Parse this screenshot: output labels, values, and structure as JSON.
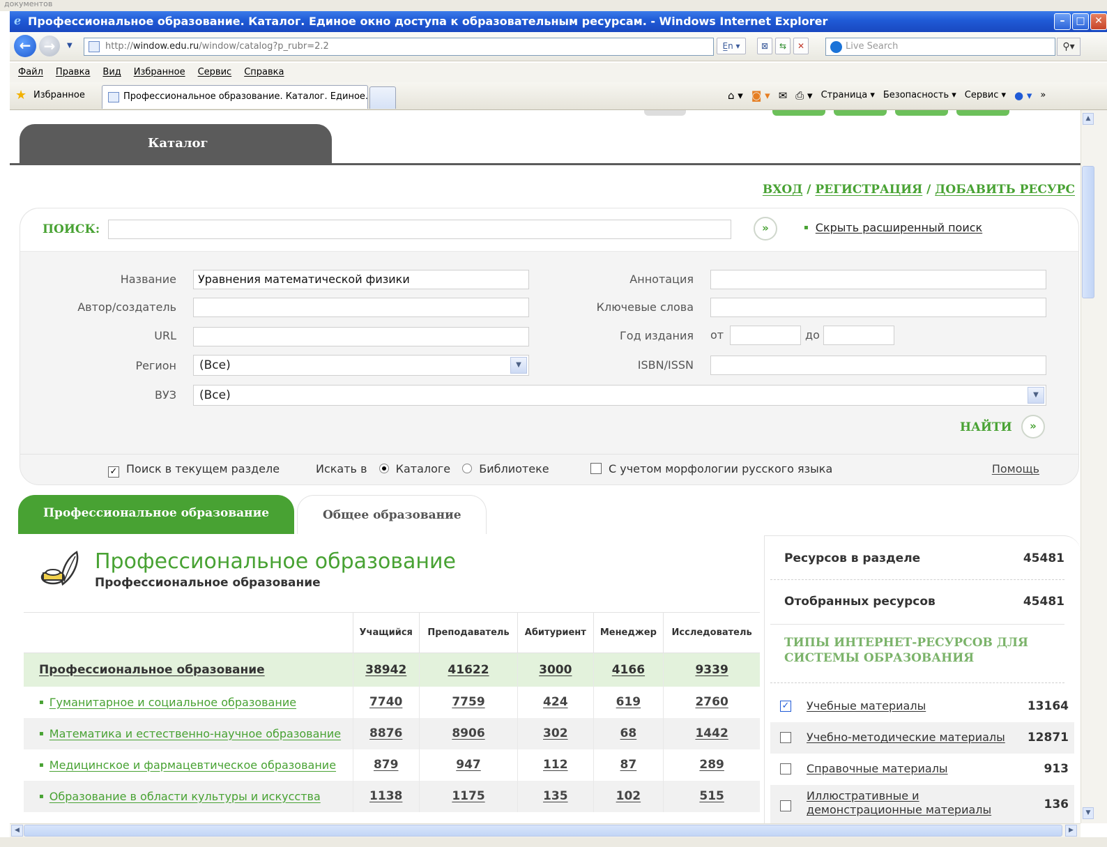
{
  "browser": {
    "top_strip": "документов",
    "window_title": "Профессиональное образование. Каталог. Единое окно доступа к образовательным ресурсам. - Windows Internet Explorer",
    "url_prefix": "http://",
    "url_host": "window.edu.ru",
    "url_path": "/window/catalog?p_rubr=2.2",
    "live_search_placeholder": "Live Search",
    "menu": [
      "Файл",
      "Правка",
      "Вид",
      "Избранное",
      "Сервис",
      "Справка"
    ],
    "favorites_label": "Избранное",
    "active_tab": "Профессиональное образование. Каталог. Единое...",
    "command_bar": [
      "Страница ▾",
      "Безопасность ▾",
      "Сервис ▾"
    ]
  },
  "page": {
    "catalog_tab": "Каталог",
    "auth": {
      "login": "ВХОД",
      "sep": " / ",
      "register": "РЕГИСТРАЦИЯ",
      "add": "ДОБАВИТЬ РЕСУРС"
    },
    "search": {
      "label": "ПОИСК:",
      "query": "",
      "hide_advanced": "Скрыть расширенный поиск",
      "fields": {
        "title_label": "Название",
        "title_value": "Уравнения математической физики",
        "author_label": "Автор/создатель",
        "author_value": "",
        "url_label": "URL",
        "url_value": "",
        "region_label": "Регион",
        "region_value": "(Все)",
        "vuz_label": "ВУЗ",
        "vuz_value": "(Все)",
        "annotation_label": "Аннотация",
        "annotation_value": "",
        "keywords_label": "Ключевые слова",
        "keywords_value": "",
        "year_label": "Год издания",
        "year_from_label": "от",
        "year_from_value": "",
        "year_to_label": "до",
        "year_to_value": "",
        "isbn_label": "ISBN/ISSN",
        "isbn_value": ""
      },
      "find_label": "НАЙТИ",
      "options": {
        "current_section": "Поиск в текущем разделе",
        "current_section_checked": true,
        "search_in": "Искать в",
        "catalog": "Каталоге",
        "library": "Библиотеке",
        "selected": "catalog",
        "morphology": "С учетом морфологии русского языка",
        "morphology_checked": false
      },
      "help": "Помощь"
    },
    "tabs": [
      {
        "label": "Профессиональное образование",
        "active": true
      },
      {
        "label": "Общее образование",
        "active": false
      }
    ],
    "section": {
      "title": "Профессиональное образование",
      "subtitle": "Профессиональное образование"
    },
    "table": {
      "columns": [
        "Учащийся",
        "Преподаватель",
        "Абитуриент",
        "Менеджер",
        "Исследователь"
      ],
      "total_row": {
        "name": "Профессиональное образование",
        "values": [
          "38942",
          "41622",
          "3000",
          "4166",
          "9339"
        ]
      },
      "rows": [
        {
          "name": "Гуманитарное и социальное образование",
          "values": [
            "7740",
            "7759",
            "424",
            "619",
            "2760"
          ]
        },
        {
          "name": "Математика и естественно-научное образование",
          "values": [
            "8876",
            "8906",
            "302",
            "68",
            "1442"
          ]
        },
        {
          "name": "Медицинское и фармацевтическое образование",
          "values": [
            "879",
            "947",
            "112",
            "87",
            "289"
          ]
        },
        {
          "name": "Образование в области культуры и искусства",
          "values": [
            "1138",
            "1175",
            "135",
            "102",
            "515"
          ]
        }
      ]
    },
    "sidebar": {
      "resources_label": "Ресурсов в разделе",
      "resources_value": "45481",
      "selected_label": "Отобранных ресурсов",
      "selected_value": "45481",
      "types_heading": "ТИПЫ ИНТЕРНЕТ-РЕСУРСОВ ДЛЯ СИСТЕМЫ ОБРАЗОВАНИЯ",
      "types": [
        {
          "label": "Учебные материалы",
          "count": "13164",
          "checked": true
        },
        {
          "label": "Учебно-методические материалы",
          "count": "12871",
          "checked": false
        },
        {
          "label": "Справочные материалы",
          "count": "913",
          "checked": false
        },
        {
          "label": "Иллюстративные и демонстрационные материалы",
          "count": "136",
          "checked": false
        }
      ]
    }
  },
  "colors": {
    "accent_green": "#48a233",
    "tab_dark": "#5b5b5b",
    "title_blue": "#1f5ad6"
  }
}
